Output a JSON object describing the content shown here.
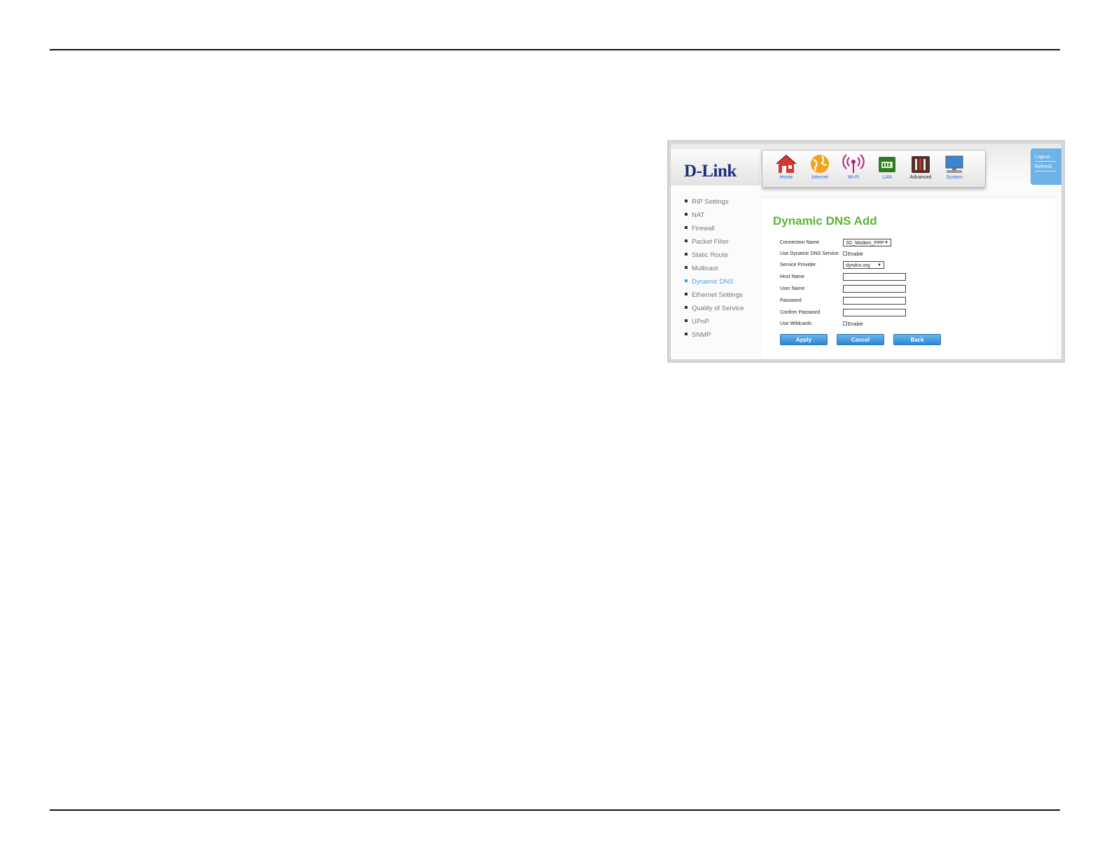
{
  "router_ui": {
    "logo": "D-Link",
    "nav": [
      {
        "label": "Home",
        "icon": "home-icon"
      },
      {
        "label": "Internet",
        "icon": "globe-icon"
      },
      {
        "label": "Wi-Fi",
        "icon": "wifi-icon"
      },
      {
        "label": "LAN",
        "icon": "lan-icon"
      },
      {
        "label": "Advanced",
        "icon": "advanced-icon"
      },
      {
        "label": "System",
        "icon": "system-icon"
      }
    ],
    "active_nav": "Advanced",
    "util_links": {
      "logout": "Logout",
      "refresh": "Refresh"
    },
    "sidebar": [
      "RIP Settings",
      "NAT",
      "Firewall",
      "Packet Filter",
      "Static Route",
      "Multicast",
      "Dynamic DNS",
      "Ethernet Settings",
      "Quality of Service",
      "UPnP",
      "SNMP"
    ],
    "active_sidebar": "Dynamic DNS",
    "form": {
      "title": "Dynamic DNS Add",
      "connection_name_label": "Connection Name",
      "connection_name_value": "3G_Modem_PPP",
      "use_ddns_label": "Use Dynamic DNS Service",
      "use_ddns_option": "Enable",
      "service_provider_label": "Service Provider",
      "service_provider_value": "dyndns.org",
      "host_name_label": "Host Name",
      "host_name_value": "",
      "user_name_label": "User Name",
      "user_name_value": "",
      "password_label": "Password",
      "password_value": "",
      "confirm_password_label": "Confirm Password",
      "confirm_password_value": "",
      "wildcards_label": "Use Wildcards",
      "wildcards_option": "Enable"
    },
    "buttons": {
      "apply": "Apply",
      "cancel": "Cancel",
      "back": "Back"
    },
    "colors": {
      "title_green": "#5cb531",
      "active_blue": "#3ba6dd",
      "button_blue": "#2d86d4",
      "logo_blue": "#1e2f7a"
    }
  }
}
